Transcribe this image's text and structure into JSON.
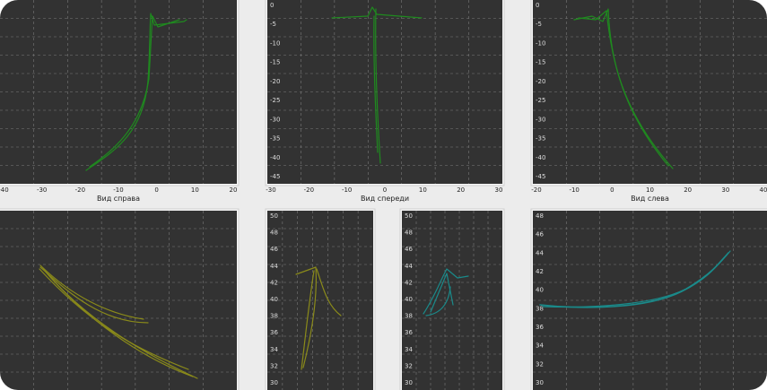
{
  "panels": [
    {
      "id": "side-right",
      "caption": "Вид справа",
      "x_ticks": [
        "-40",
        "-30",
        "-20",
        "-10",
        "0",
        "10",
        "20"
      ],
      "y_ticks": [],
      "color": "#1f8a1f"
    },
    {
      "id": "front",
      "caption": "Вид спереди",
      "x_ticks": [
        "-30",
        "-20",
        "-10",
        "0",
        "10",
        "20",
        "30"
      ],
      "y_ticks": [
        "0",
        "-5",
        "-10",
        "-15",
        "-20",
        "-25",
        "-30",
        "-35",
        "-40",
        "-45"
      ],
      "color": "#1f8a1f"
    },
    {
      "id": "side-left",
      "caption": "Вид слева",
      "x_ticks": [
        "-20",
        "-10",
        "0",
        "10",
        "20",
        "30",
        "40"
      ],
      "y_ticks": [
        "0",
        "-5",
        "-10",
        "-15",
        "-20",
        "-25",
        "-30",
        "-35",
        "-40",
        "-45"
      ],
      "color": "#1f8a1f"
    },
    {
      "id": "bottom-1",
      "caption": "",
      "x_ticks": [],
      "y_ticks": [],
      "color": "#8a8a1a"
    },
    {
      "id": "bottom-2",
      "caption": "",
      "x_ticks": [],
      "y_ticks": [
        "50",
        "48",
        "46",
        "44",
        "42",
        "40",
        "38",
        "36",
        "34",
        "32",
        "30"
      ],
      "color": "#8a8a1a"
    },
    {
      "id": "bottom-3",
      "caption": "",
      "x_ticks": [],
      "y_ticks": [
        "50",
        "48",
        "46",
        "44",
        "42",
        "40",
        "38",
        "36",
        "34",
        "32",
        "30"
      ],
      "color": "#1a8a8a"
    },
    {
      "id": "bottom-4",
      "caption": "",
      "x_ticks": [],
      "y_ticks": [
        "48",
        "46",
        "44",
        "42",
        "40",
        "38",
        "36",
        "34",
        "32",
        "30"
      ],
      "color": "#1a8a8a"
    }
  ],
  "colors": {
    "plot_bg": "#323232",
    "grid": "#7a7a7a",
    "frame": "#cfcfcf",
    "window_bg": "#ececec"
  }
}
